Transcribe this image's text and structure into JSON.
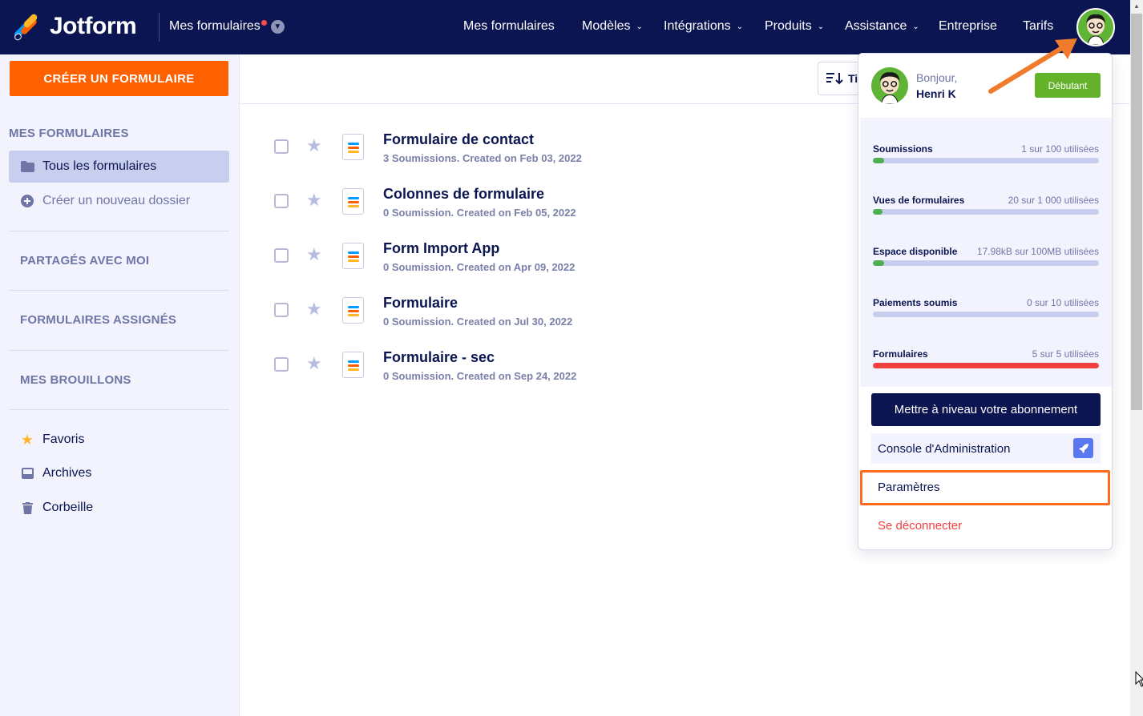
{
  "brand": {
    "name": "Jotform"
  },
  "header": {
    "switcher_label": "Mes formulaires",
    "nav": [
      {
        "label": "Mes formulaires",
        "caret": false
      },
      {
        "label": "Modèles",
        "caret": true
      },
      {
        "label": "Intégrations",
        "caret": true
      },
      {
        "label": "Produits",
        "caret": true
      },
      {
        "label": "Assistance",
        "caret": true
      },
      {
        "label": "Entreprise",
        "caret": false
      },
      {
        "label": "Tarifs",
        "caret": false
      }
    ]
  },
  "sidebar": {
    "create_label": "CRÉER UN FORMULAIRE",
    "section_my_forms": "MES FORMULAIRES",
    "all_forms": "Tous les formulaires",
    "new_folder": "Créer un nouveau dossier",
    "shared": "PARTAGÉS AVEC MOI",
    "assigned": "FORMULAIRES ASSIGNÉS",
    "drafts": "MES BROUILLONS",
    "favorites": "Favoris",
    "archives": "Archives",
    "trash": "Corbeille"
  },
  "toolbar": {
    "sort_label": "Ti"
  },
  "forms": [
    {
      "title": "Formulaire de contact",
      "meta": "3 Soumissions. Created on Feb 03, 2022"
    },
    {
      "title": "Colonnes de formulaire",
      "meta": "0 Soumission. Created on Feb 05, 2022"
    },
    {
      "title": "Form Import App",
      "meta": "0 Soumission. Created on Apr 09, 2022"
    },
    {
      "title": "Formulaire",
      "meta": "0 Soumission. Created on Jul 30, 2022"
    },
    {
      "title": "Formulaire - sec",
      "meta": "0 Soumission. Created on Sep 24, 2022"
    }
  ],
  "account": {
    "greeting": "Bonjour,",
    "name": "Henri K",
    "plan": "Débutant",
    "usage": [
      {
        "label": "Soumissions",
        "value": "1 sur 100 utilisées",
        "fraction": 0.05,
        "color": "#4cb050"
      },
      {
        "label": "Vues de formulaires",
        "value": "20 sur 1 000 utilisées",
        "fraction": 0.02,
        "color": "#4cb050"
      },
      {
        "label": "Espace disponible",
        "value": "17.98kB sur 100MB utilisées",
        "fraction": 0.05,
        "color": "#4cb050"
      },
      {
        "label": "Paiements soumis",
        "value": "0 sur 10 utilisées",
        "fraction": 0.0,
        "color": "#4cb050"
      },
      {
        "label": "Formulaires",
        "value": "5 sur 5 utilisées",
        "fraction": 1.0,
        "color": "#f2403f"
      }
    ],
    "upgrade_label": "Mettre à niveau votre abonnement",
    "console_label": "Console d'Administration",
    "settings_label": "Paramètres",
    "logout_label": "Se déconnecter"
  },
  "colors": {
    "navy": "#0a1551",
    "orange": "#ff6100",
    "annotation": "#ff6a1f"
  }
}
